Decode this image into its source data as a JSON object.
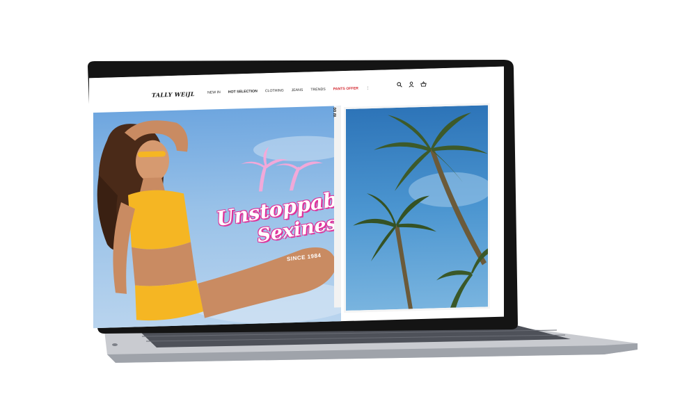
{
  "brand": {
    "logo": "TALLY WEiJL"
  },
  "nav": {
    "items": [
      {
        "label": "NEW IN",
        "style": "normal"
      },
      {
        "label": "HOT SELECTION",
        "style": "bold"
      },
      {
        "label": "CLOTHING",
        "style": "normal"
      },
      {
        "label": "JEANS",
        "style": "normal"
      },
      {
        "label": "TRENDS",
        "style": "normal"
      },
      {
        "label": "PANTS OFFER",
        "style": "red"
      }
    ],
    "more_icon": "more-vertical-icon",
    "icons": [
      "search-icon",
      "user-icon",
      "cart-icon"
    ]
  },
  "hero": {
    "headline_line1": "Unstoppable",
    "headline_line2": "Sexiness",
    "tagline": "SINCE 1984",
    "side_text": "W 00"
  },
  "colors": {
    "accent_red": "#d3262e",
    "headline_pink": "#e0339b",
    "sky_blue": "#6ea6df",
    "swimsuit_yellow": "#f5b623"
  }
}
